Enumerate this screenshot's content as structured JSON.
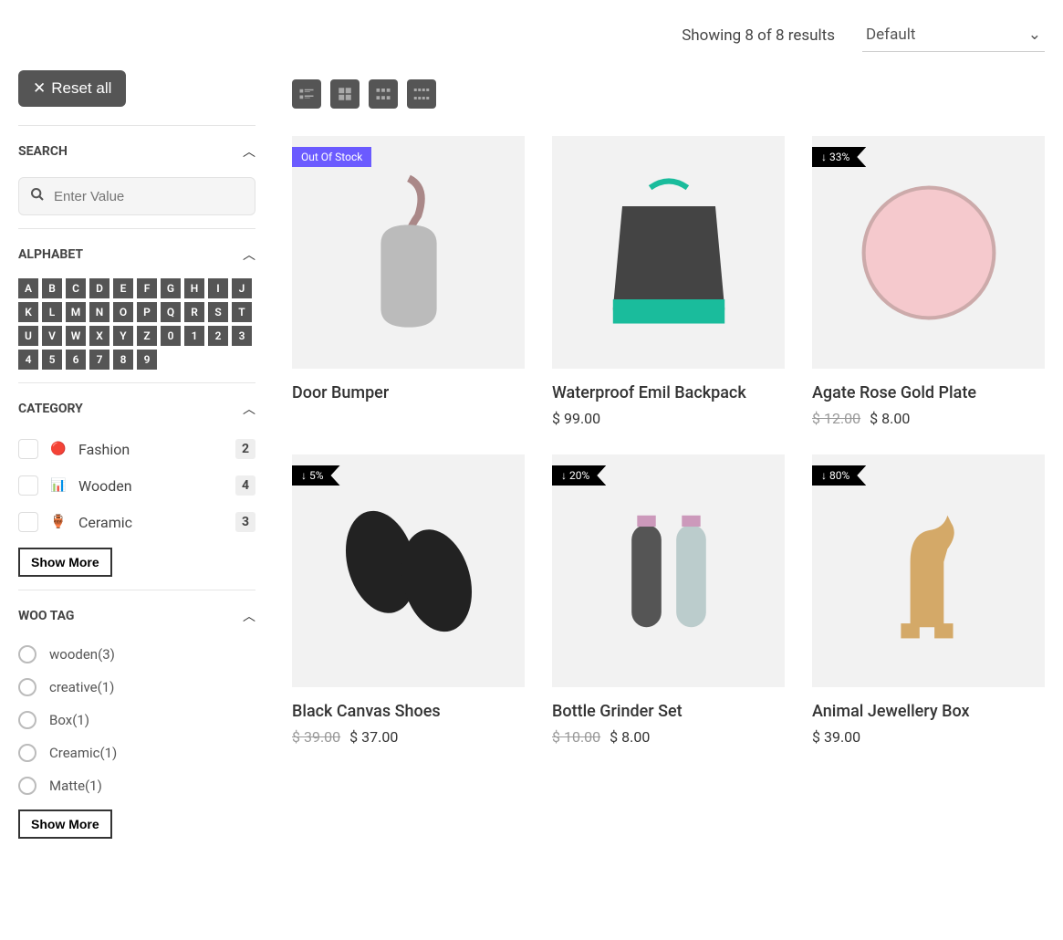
{
  "topbar": {
    "showing": "Showing 8 of 8 results",
    "sort_selected": "Default"
  },
  "reset_label": "Reset all",
  "sections": {
    "search": {
      "title": "SEARCH",
      "placeholder": "Enter Value"
    },
    "alphabet": {
      "title": "ALPHABET",
      "items": [
        "A",
        "B",
        "C",
        "D",
        "E",
        "F",
        "G",
        "H",
        "I",
        "J",
        "K",
        "L",
        "M",
        "N",
        "O",
        "P",
        "Q",
        "R",
        "S",
        "T",
        "U",
        "V",
        "W",
        "X",
        "Y",
        "Z",
        "0",
        "1",
        "2",
        "3",
        "4",
        "5",
        "6",
        "7",
        "8",
        "9"
      ]
    },
    "category": {
      "title": "CATEGORY",
      "items": [
        {
          "label": "Fashion",
          "count": "2"
        },
        {
          "label": "Wooden",
          "count": "4"
        },
        {
          "label": "Ceramic",
          "count": "3"
        }
      ],
      "show_more": "Show More"
    },
    "wootag": {
      "title": "WOO TAG",
      "items": [
        {
          "label": "wooden",
          "count": "(3)"
        },
        {
          "label": "creative",
          "count": "(1)"
        },
        {
          "label": "Box",
          "count": "(1)"
        },
        {
          "label": "Creamic",
          "count": "(1)"
        },
        {
          "label": "Matte",
          "count": "(1)"
        }
      ],
      "show_more": "Show More"
    }
  },
  "products": [
    {
      "title": "Door Bumper",
      "price": "",
      "old_price": "",
      "badge_type": "oos",
      "badge_text": "Out Of Stock"
    },
    {
      "title": "Waterproof Emil Backpack",
      "price": "$ 99.00",
      "old_price": "",
      "badge_type": "",
      "badge_text": ""
    },
    {
      "title": "Agate Rose Gold Plate",
      "price": "$ 8.00",
      "old_price": "$ 12.00",
      "badge_type": "disc",
      "badge_text": "↓ 33%"
    },
    {
      "title": "Black Canvas Shoes",
      "price": "$ 37.00",
      "old_price": "$ 39.00",
      "badge_type": "disc",
      "badge_text": "↓ 5%"
    },
    {
      "title": "Bottle Grinder Set",
      "price": "$ 8.00",
      "old_price": "$ 10.00",
      "badge_type": "disc",
      "badge_text": "↓ 20%"
    },
    {
      "title": "Animal Jewellery Box",
      "price": "$ 39.00",
      "old_price": "",
      "badge_type": "disc",
      "badge_text": "↓ 80%"
    }
  ]
}
